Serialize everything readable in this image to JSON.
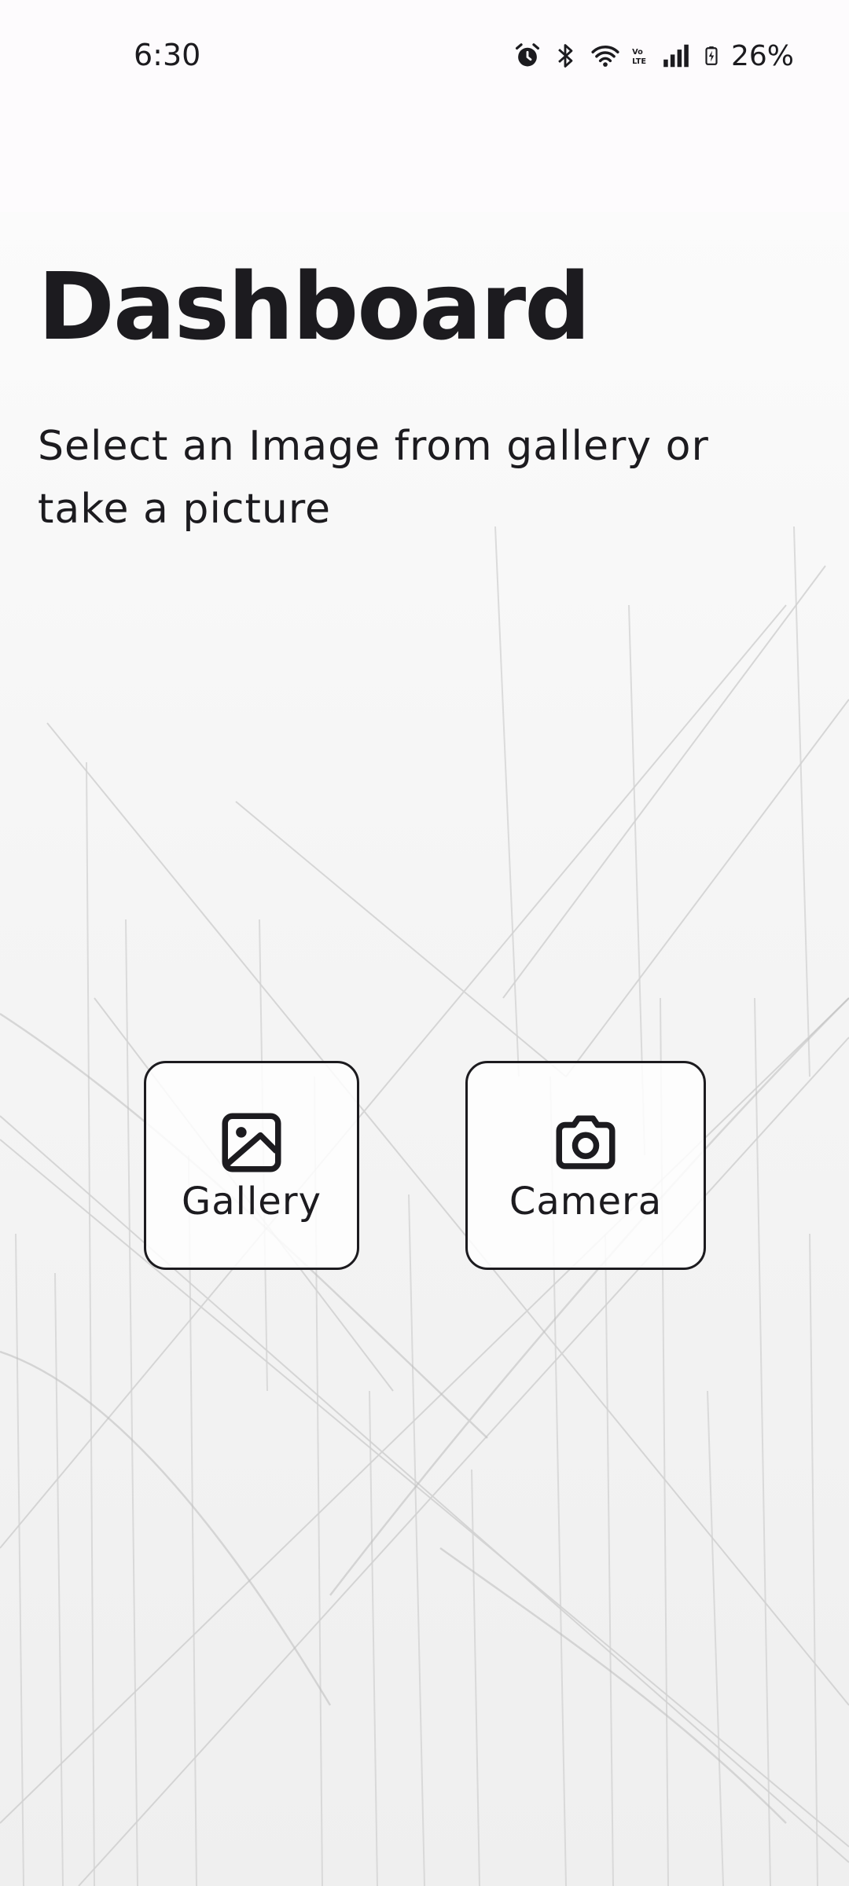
{
  "status_bar": {
    "time": "6:30",
    "battery_percent": "26%",
    "icons": [
      "alarm-icon",
      "bluetooth-icon",
      "wifi-icon",
      "volte-icon",
      "signal-icon",
      "battery-charging-icon"
    ]
  },
  "header": {
    "title": "Dashboard",
    "subtitle": "Select an Image from gallery or take a picture"
  },
  "actions": {
    "gallery": {
      "label": "Gallery",
      "icon": "image-icon"
    },
    "camera": {
      "label": "Camera",
      "icon": "camera-icon"
    }
  },
  "colors": {
    "text": "#1c1b1f",
    "background": "#fdfbfd",
    "border": "#1c1b1f"
  }
}
